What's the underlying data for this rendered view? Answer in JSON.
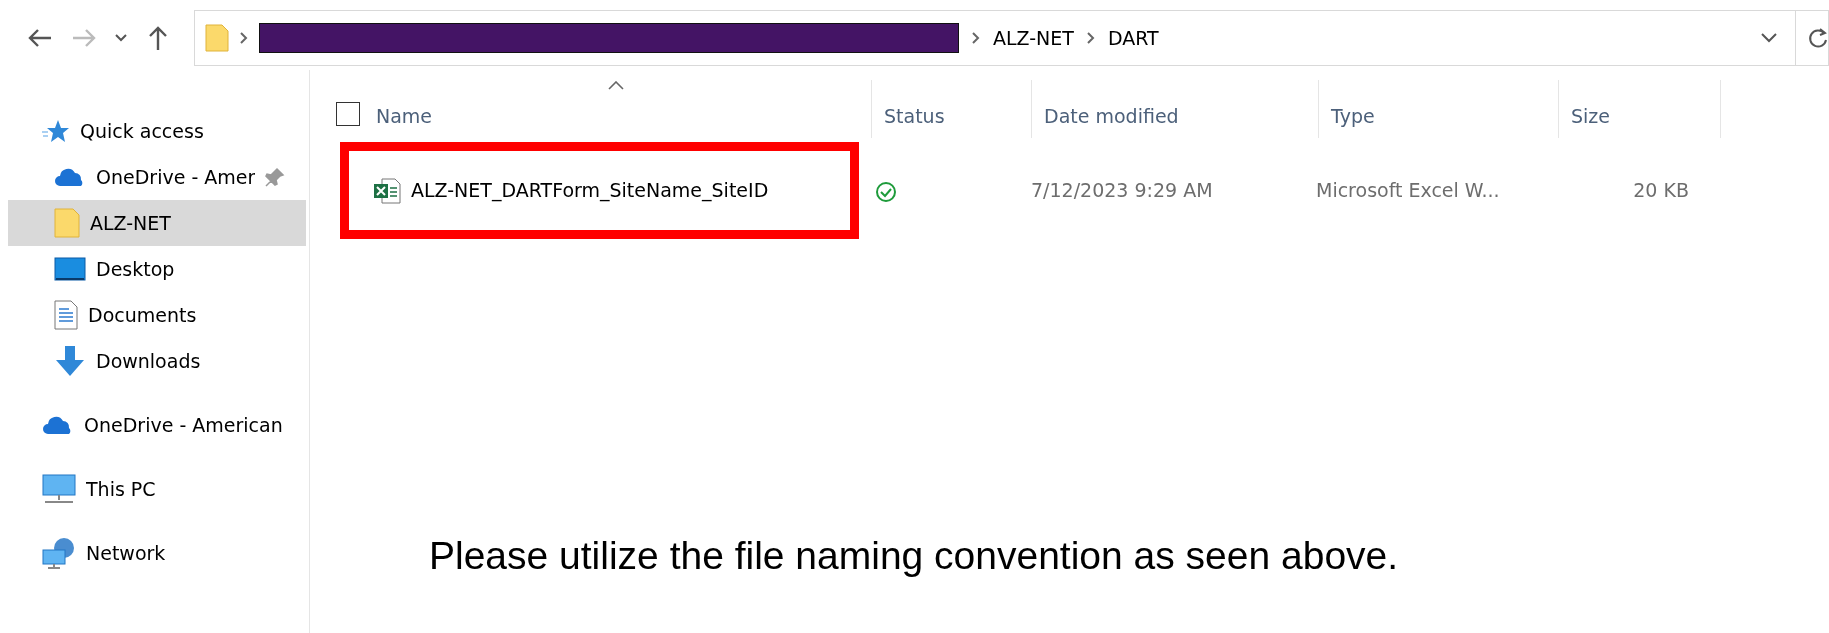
{
  "address_bar": {
    "redacted": true,
    "breadcrumbs": [
      "ALZ-NET",
      "DART"
    ]
  },
  "sidebar": {
    "items": [
      {
        "label": "Quick access",
        "kind": "quick",
        "selected": false,
        "pinned": false,
        "children": [
          {
            "label": "OneDrive - Amer",
            "kind": "cloud",
            "selected": false,
            "pinned": true
          },
          {
            "label": "ALZ-NET",
            "kind": "folder",
            "selected": true,
            "pinned": false
          },
          {
            "label": "Desktop",
            "kind": "desktop",
            "selected": false,
            "pinned": false
          },
          {
            "label": "Documents",
            "kind": "documents",
            "selected": false,
            "pinned": false
          },
          {
            "label": "Downloads",
            "kind": "downloads",
            "selected": false,
            "pinned": false
          }
        ]
      },
      {
        "label": "OneDrive - American",
        "kind": "cloud",
        "selected": false,
        "pinned": false
      },
      {
        "label": "This PC",
        "kind": "pc",
        "selected": false,
        "pinned": false
      },
      {
        "label": "Network",
        "kind": "network",
        "selected": false,
        "pinned": false
      }
    ]
  },
  "table": {
    "select_all_checked": false,
    "columns": [
      {
        "label": "Name",
        "sorted": true
      },
      {
        "label": "Status",
        "sorted": false
      },
      {
        "label": "Date modified",
        "sorted": false
      },
      {
        "label": "Type",
        "sorted": false
      },
      {
        "label": "Size",
        "sorted": false
      }
    ],
    "rows": [
      {
        "name": "ALZ-NET_DARTForm_SiteName_SiteID",
        "kind": "synced",
        "date_modified": "7/12/2023 9:29 AM",
        "type": "Microsoft Excel W...",
        "size": "20 KB",
        "annotated": true,
        "selected": false
      }
    ]
  },
  "note": "Please utilize the file naming convention as seen above."
}
